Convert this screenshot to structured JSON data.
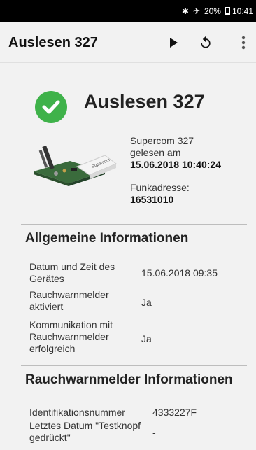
{
  "status_bar": {
    "bluetooth_icon": "bluetooth-icon",
    "airplane_icon": "airplane-icon",
    "battery": "20%",
    "time": "10:41"
  },
  "appbar": {
    "title": "Auslesen 327",
    "actions": [
      "play-icon",
      "refresh-icon",
      "more-vert-icon"
    ]
  },
  "hero": {
    "status_icon": "check-circle-icon",
    "status_color": "#3fb24a",
    "title": "Auslesen 327"
  },
  "device": {
    "image": "device-module-icon",
    "name": "Supercom 327",
    "read_at_label": "gelesen am",
    "read_at_value": "15.06.2018 10:40:24",
    "address_label": "Funkadresse:",
    "address_value": "16531010"
  },
  "general": {
    "title": "Allgemeine Informationen",
    "rows": [
      {
        "label": "Datum und Zeit des Gerätes",
        "value": "15.06.2018 09:35"
      },
      {
        "label": "Rauchwarnmelder aktiviert",
        "value": "Ja"
      },
      {
        "label": "Kommunikation mit Rauchwarnmelder erfolgreich",
        "value": "Ja"
      }
    ]
  },
  "smoke": {
    "title": "Rauchwarnmelder Informationen",
    "rows": [
      {
        "label": "Identifikationsnummer",
        "value": "4333227F"
      },
      {
        "label": "Letztes Datum \"Testknopf gedrückt\"",
        "value": "-"
      }
    ]
  }
}
